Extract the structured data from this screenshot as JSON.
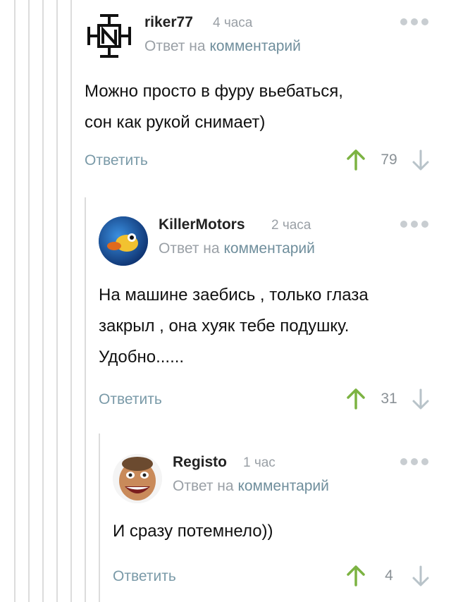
{
  "comments": [
    {
      "username": "riker77",
      "time": "4 часа",
      "reply_prefix": "Ответ на",
      "reply_link": "комментарий",
      "text": "Можно просто в фуру вьебаться,\nсон как рукой снимает)",
      "reply_label": "Ответить",
      "rating": "79"
    },
    {
      "username": "KillerMotors",
      "time": "2 часа",
      "reply_prefix": "Ответ на",
      "reply_link": "комментарий",
      "text": "На машине заебись , только глаза\nзакрыл , она хуяк тебе подушку.\nУдобно......",
      "reply_label": "Ответить",
      "rating": "31"
    },
    {
      "username": "Registo",
      "time": "1 час",
      "reply_prefix": "Ответ на",
      "reply_link": "комментарий",
      "text": "И сразу потемнело))",
      "reply_label": "Ответить",
      "rating": "4"
    }
  ],
  "colors": {
    "upvote": "#7cb342",
    "link": "#6f8e9c",
    "muted": "#9aa0a6",
    "thread_line": "#dcdcdc"
  },
  "icons": [
    "upvote-arrow-icon",
    "downvote-arrow-icon",
    "more-dots-icon"
  ]
}
